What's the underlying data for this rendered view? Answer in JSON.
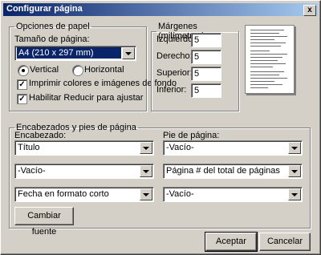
{
  "window": {
    "title": "Configurar página",
    "close_label": "x"
  },
  "paper": {
    "legend": "Opciones de papel",
    "size_label": "Tamaño de página:",
    "size_value": "A4 (210 x 297 mm)",
    "orientation_vertical": "Vertical",
    "orientation_horizontal": "Horizontal",
    "orientation_selected": "Vertical",
    "print_backgrounds": "Imprimir colores e imágenes de fondo",
    "print_backgrounds_checked": true,
    "shrink_to_fit": "Habilitar Reducir para ajustar",
    "shrink_to_fit_checked": true
  },
  "margins": {
    "legend": "Márgenes (milímetros)",
    "left_label": "Izquierdo:",
    "left_value": "5",
    "right_label": "Derecho:",
    "right_value": "5",
    "top_label": "Superior:",
    "top_value": "5",
    "bottom_label": "Inferior:",
    "bottom_value": "5"
  },
  "headers": {
    "legend": "Encabezados y pies de página",
    "header_label": "Encabezado:",
    "footer_label": "Pie de página:",
    "header_1": "Título",
    "header_2": "-Vacío-",
    "header_3": "Fecha en formato corto",
    "footer_1": "-Vacío-",
    "footer_2": "Página # del total de páginas",
    "footer_3": "-Vacío-",
    "change_font": "Cambiar fuente"
  },
  "buttons": {
    "ok": "Aceptar",
    "cancel": "Cancelar"
  }
}
